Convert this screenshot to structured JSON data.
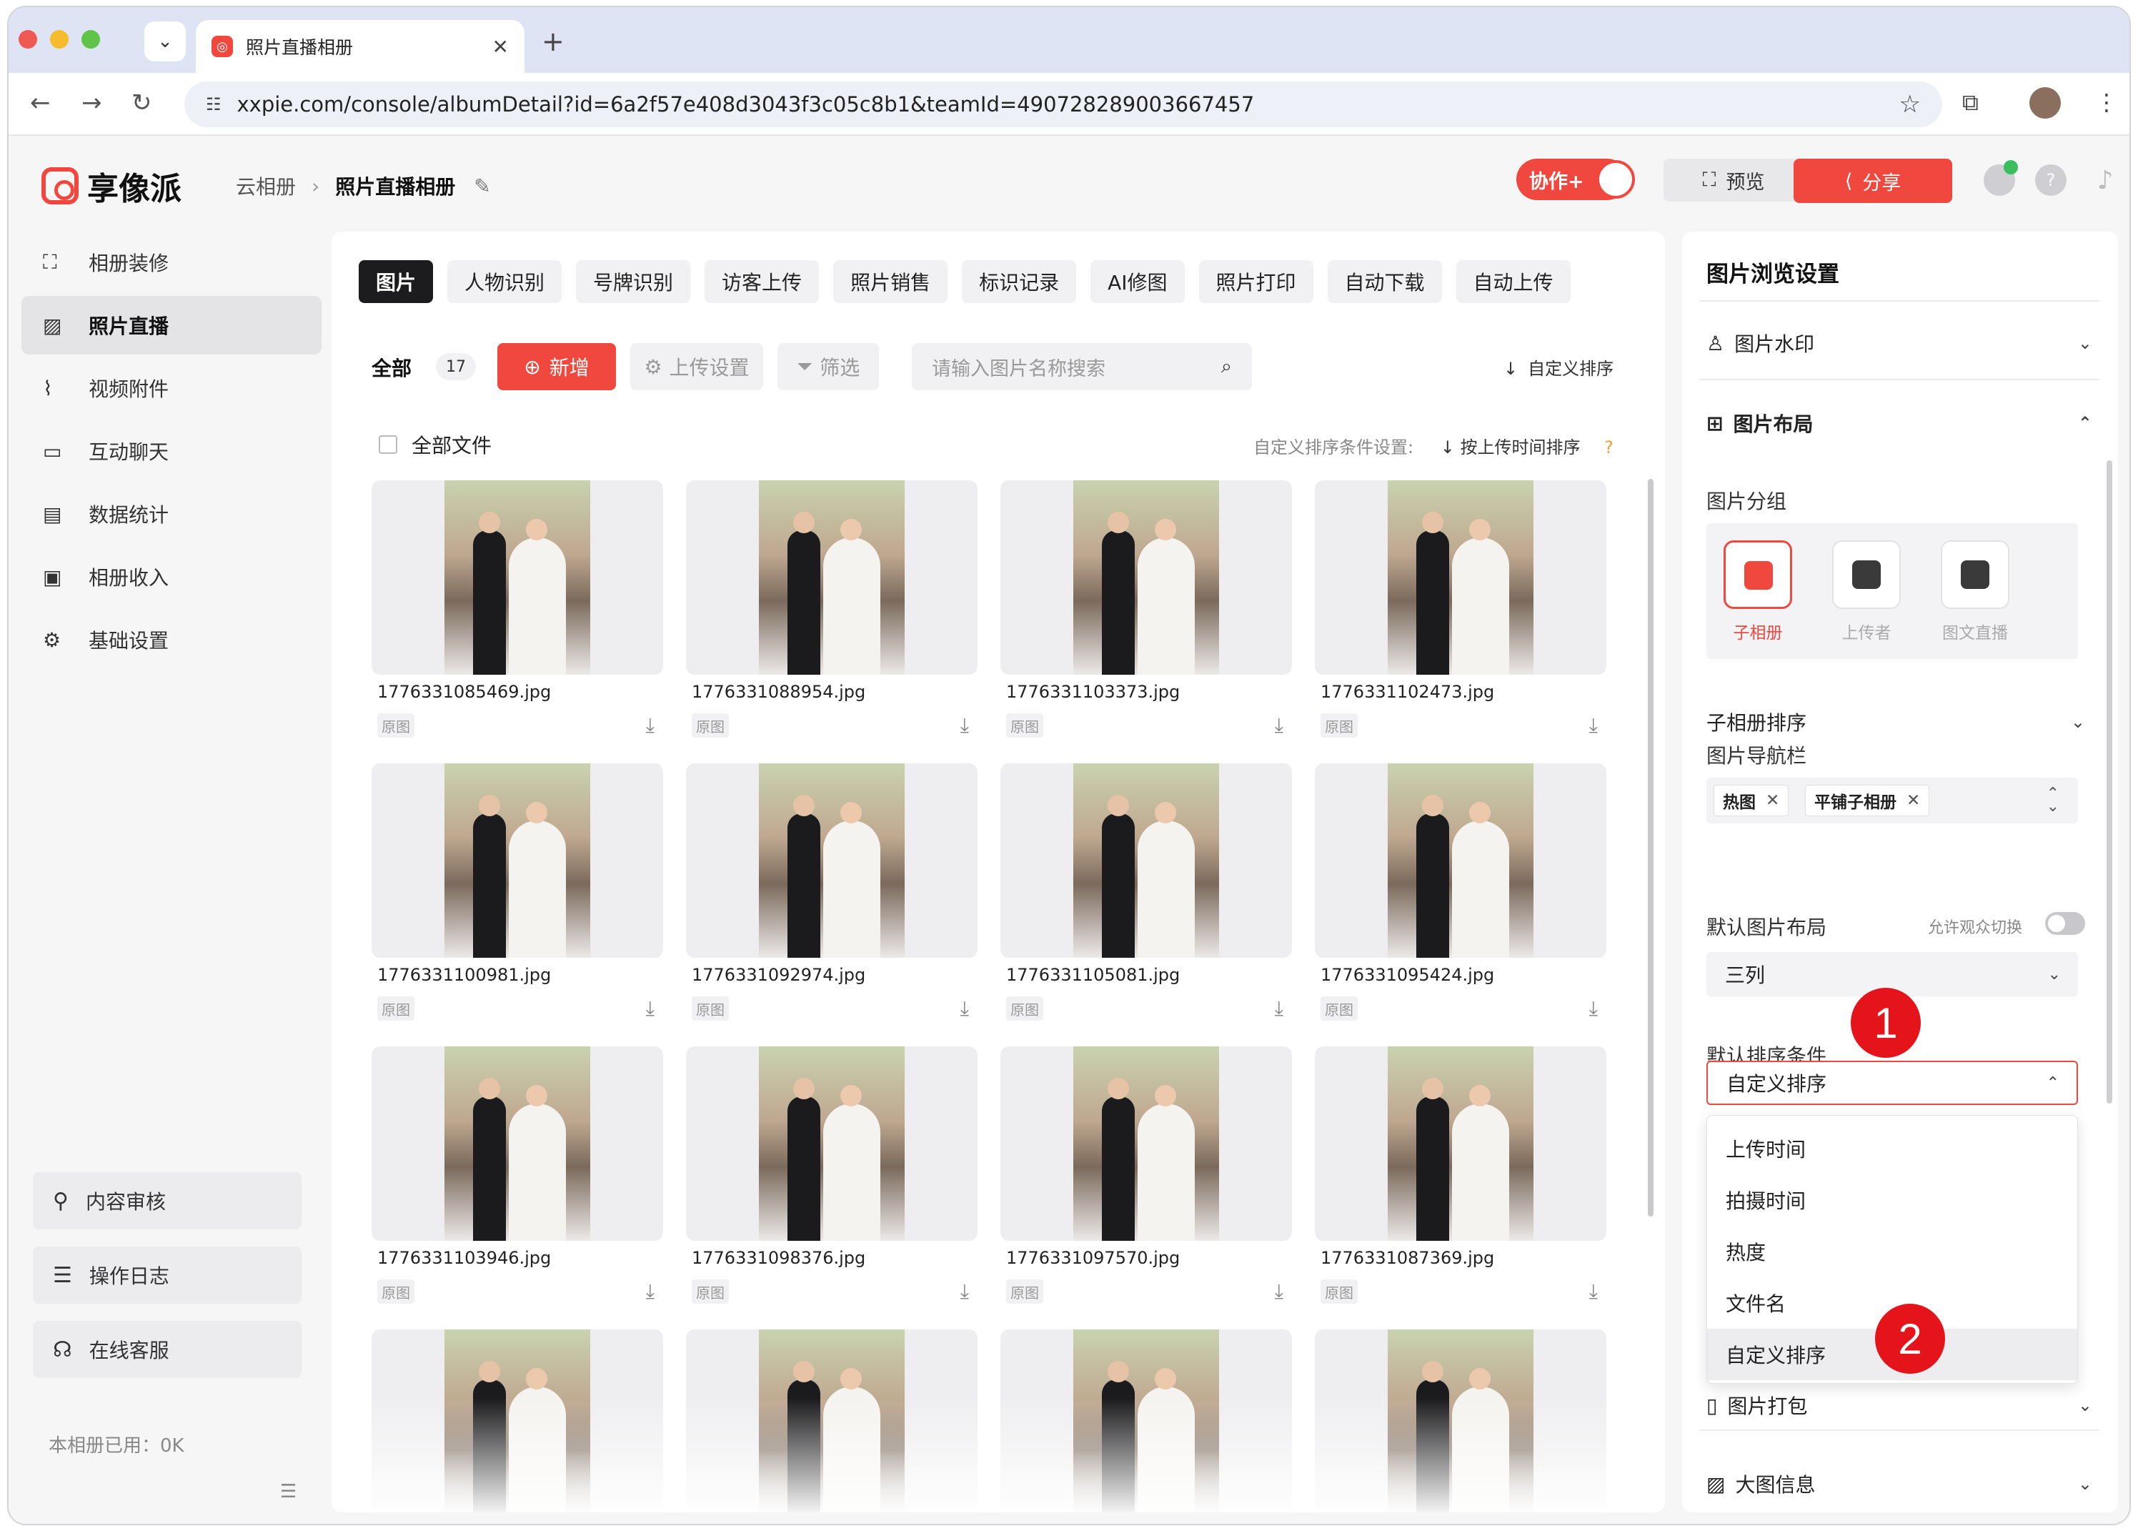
{
  "browser": {
    "tab_title": "照片直播相册",
    "url": "xxpie.com/console/albumDetail?id=6a2f57e408d3043f3c05c8b1&teamId=490728289003667457",
    "traffic_colors": [
      "#ee5a52",
      "#f5bd2e",
      "#5fc447"
    ]
  },
  "header": {
    "logo_text": "享像派",
    "breadcrumb": [
      "云相册",
      "照片直播相册"
    ],
    "collab_label": "协作+",
    "preview_label": "预览",
    "share_label": "分享",
    "accent": "#f0483e"
  },
  "sidebar": {
    "items": [
      {
        "label": "相册装修",
        "icon": "frame-icon"
      },
      {
        "label": "照片直播",
        "icon": "image-icon"
      },
      {
        "label": "视频附件",
        "icon": "paperclip-icon"
      },
      {
        "label": "互动聊天",
        "icon": "chat-icon"
      },
      {
        "label": "数据统计",
        "icon": "chart-icon"
      },
      {
        "label": "相册收入",
        "icon": "wallet-icon"
      },
      {
        "label": "基础设置",
        "icon": "gear-icon"
      }
    ],
    "bottom": [
      {
        "label": "内容审核",
        "icon": "stamp-icon"
      },
      {
        "label": "操作日志",
        "icon": "log-icon"
      },
      {
        "label": "在线客服",
        "icon": "headset-icon"
      }
    ],
    "usage": "本相册已用：0K"
  },
  "main": {
    "tabs": [
      "图片",
      "人物识别",
      "号牌识别",
      "访客上传",
      "照片销售",
      "标识记录",
      "AI修图",
      "照片打印",
      "自动下载",
      "自动上传"
    ],
    "all_label": "全部",
    "count": "17",
    "add_label": "新增",
    "upload_settings_label": "上传设置",
    "filter_label": "筛选",
    "search_placeholder": "请输入图片名称搜索",
    "sort_label": "自定义排序",
    "select_all_label": "全部文件",
    "sort_setting_label": "自定义排序条件设置:",
    "sort_setting_value": "按上传时间排序",
    "tag_label": "原图",
    "photos": [
      "1776331085469.jpg",
      "1776331088954.jpg",
      "1776331103373.jpg",
      "1776331102473.jpg",
      "1776331100981.jpg",
      "1776331092974.jpg",
      "1776331105081.jpg",
      "1776331095424.jpg",
      "1776331103946.jpg",
      "1776331098376.jpg",
      "1776331097570.jpg",
      "1776331087369.jpg"
    ]
  },
  "panel": {
    "title": "图片浏览设置",
    "watermark_label": "图片水印",
    "layout_label": "图片布局",
    "group_label": "图片分组",
    "group_options": [
      "子相册",
      "上传者",
      "图文直播"
    ],
    "sub_sort_label": "子相册排序",
    "navbar_label": "图片导航栏",
    "nav_chips": [
      "热图",
      "平铺子相册"
    ],
    "default_layout_label": "默认图片布局",
    "allow_switch_label": "允许观众切换",
    "default_layout_value": "三列",
    "default_sort_label": "默认排序条件",
    "default_sort_value": "自定义排序",
    "sort_options": [
      "上传时间",
      "拍摄时间",
      "热度",
      "文件名",
      "自定义排序"
    ],
    "pack_label": "图片打包",
    "bigimg_label": "大图信息",
    "badge1": "1",
    "badge2": "2"
  }
}
